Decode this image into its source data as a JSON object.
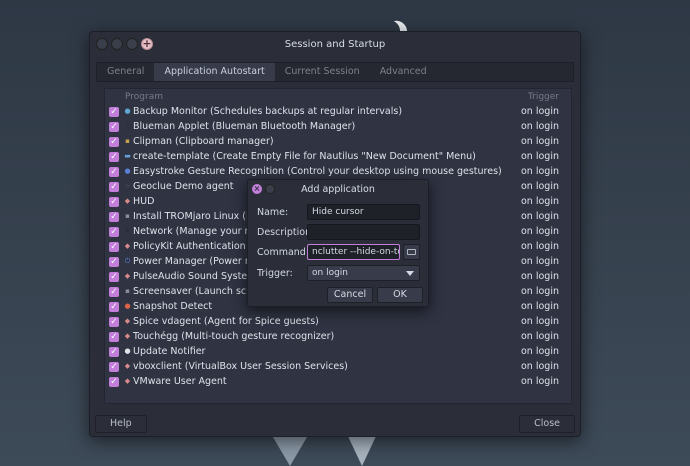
{
  "window": {
    "title": "Session and Startup",
    "tabs": [
      "General",
      "Application Autostart",
      "Current Session",
      "Advanced"
    ],
    "active_tab": "Application Autostart"
  },
  "list": {
    "col_program": "Program",
    "col_trigger": "Trigger",
    "rows": [
      {
        "name": "Backup Monitor (Schedules backups at regular intervals)",
        "trigger": "on login",
        "checked": true,
        "icon": "backup-icon",
        "icon_color": "#5fa8d3",
        "glyph": "●"
      },
      {
        "name": "Blueman Applet (Blueman Bluetooth Manager)",
        "trigger": "on login",
        "checked": true,
        "icon": "bluetooth-icon",
        "icon_color": "#2b2e39",
        "glyph": "ᛒ"
      },
      {
        "name": "Clipman (Clipboard manager)",
        "trigger": "on login",
        "checked": true,
        "icon": "clipboard-icon",
        "icon_color": "#c8a04a",
        "glyph": "▪"
      },
      {
        "name": "create-template (Create Empty File for Nautilus \"New Document\" Menu)",
        "trigger": "on login",
        "checked": true,
        "icon": "folder-icon",
        "icon_color": "#6aa0d8",
        "glyph": "▬"
      },
      {
        "name": "Easystroke Gesture Recognition (Control your desktop using mouse gestures)",
        "trigger": "on login",
        "checked": true,
        "icon": "gesture-icon",
        "icon_color": "#5b7fd6",
        "glyph": "●"
      },
      {
        "name": "Geoclue Demo agent",
        "trigger": "on login",
        "checked": true,
        "icon": "terminal-icon",
        "icon_color": "#4a4f5c",
        "glyph": ">"
      },
      {
        "name": "HUD",
        "trigger": "on login",
        "checked": true,
        "icon": "generic-app-icon",
        "icon_color": "#d88a8a",
        "glyph": "◆"
      },
      {
        "name": "Install TROMjaro Linux (Install th",
        "trigger": "on login",
        "checked": true,
        "icon": "installer-icon",
        "icon_color": "#8a8f99",
        "glyph": "▪"
      },
      {
        "name": "Network (Manage your network c",
        "trigger": "on login",
        "checked": true,
        "icon": "network-icon",
        "icon_color": "#2b2e39",
        "glyph": "▼"
      },
      {
        "name": "PolicyKit Authentication Agent (I",
        "trigger": "on login",
        "checked": true,
        "icon": "policykit-icon",
        "icon_color": "#d88a8a",
        "glyph": "◆"
      },
      {
        "name": "Power Manager (Power manager",
        "trigger": "on login",
        "checked": true,
        "icon": "power-icon",
        "icon_color": "#5b7fd6",
        "glyph": "⏻"
      },
      {
        "name": "PulseAudio Sound System (Start t",
        "trigger": "on login",
        "checked": true,
        "icon": "audio-icon",
        "icon_color": "#d88a8a",
        "glyph": "◆"
      },
      {
        "name": "Screensaver (Launch screensaver",
        "trigger": "on login",
        "checked": true,
        "icon": "screensaver-icon",
        "icon_color": "#8a8f99",
        "glyph": "▪"
      },
      {
        "name": "Snapshot Detect",
        "trigger": "on login",
        "checked": true,
        "icon": "snapshot-icon",
        "icon_color": "#d8644a",
        "glyph": "●"
      },
      {
        "name": "Spice vdagent (Agent for Spice guests)",
        "trigger": "on login",
        "checked": true,
        "icon": "generic-app-icon",
        "icon_color": "#d88a8a",
        "glyph": "◆"
      },
      {
        "name": "Touchégg (Multi-touch gesture recognizer)",
        "trigger": "on login",
        "checked": true,
        "icon": "touch-icon",
        "icon_color": "#d88a8a",
        "glyph": "◆"
      },
      {
        "name": "Update Notifier",
        "trigger": "on login",
        "checked": true,
        "icon": "update-icon",
        "icon_color": "#e0e4ea",
        "glyph": "●"
      },
      {
        "name": "vboxclient (VirtualBox User Session Services)",
        "trigger": "on login",
        "checked": true,
        "icon": "generic-app-icon",
        "icon_color": "#d88a8a",
        "glyph": "◆"
      },
      {
        "name": "VMware User Agent",
        "trigger": "on login",
        "checked": true,
        "icon": "generic-app-icon",
        "icon_color": "#d88a8a",
        "glyph": "◆"
      }
    ]
  },
  "list_toolbar": {
    "add": "+",
    "remove": "—",
    "edit": "✎"
  },
  "buttons": {
    "help": "Help",
    "close": "Close"
  },
  "dialog": {
    "title": "Add application",
    "name_label": "Name:",
    "name_value": "Hide cursor",
    "description_label": "Description:",
    "description_value": "",
    "command_label": "Command:",
    "command_value": "nclutter --hide-on-touch",
    "trigger_label": "Trigger:",
    "trigger_value": "on login",
    "cancel": "Cancel",
    "ok": "OK"
  },
  "colors": {
    "accent": "#c37ed9",
    "window_bg": "#2b2e39",
    "list_bg": "#2f3342"
  }
}
